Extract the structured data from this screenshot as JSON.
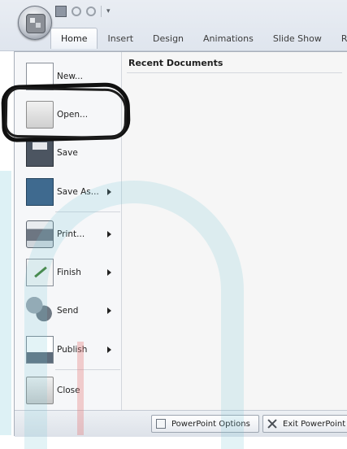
{
  "ribbon": {
    "tabs": [
      "Home",
      "Insert",
      "Design",
      "Animations",
      "Slide Show",
      "R"
    ]
  },
  "quick_access": {
    "icons": [
      "save-icon",
      "undo-icon",
      "redo-icon",
      "customize-icon"
    ]
  },
  "menu": {
    "items": [
      {
        "label": "New...",
        "icon": "new-document-icon"
      },
      {
        "label": "Open...",
        "icon": "open-folder-icon"
      },
      {
        "label": "Save",
        "icon": "floppy-disk-icon"
      },
      {
        "label": "Save As...",
        "icon": "save-as-icon",
        "submenu": true
      },
      {
        "label": "Print...",
        "icon": "printer-icon",
        "submenu": true
      },
      {
        "label": "Finish",
        "icon": "finish-icon",
        "submenu": true
      },
      {
        "label": "Send",
        "icon": "send-icon",
        "submenu": true
      },
      {
        "label": "Publish",
        "icon": "publish-icon",
        "submenu": true
      },
      {
        "label": "Close",
        "icon": "close-folder-icon"
      }
    ]
  },
  "recent": {
    "title": "Recent Documents"
  },
  "footer": {
    "options_label": "PowerPoint Options",
    "exit_label": "Exit PowerPoint"
  },
  "colors": {
    "highlight_scribble": "#101010",
    "ribbon_bg": "#dfe5ee",
    "watermark": "#78c8d7"
  }
}
